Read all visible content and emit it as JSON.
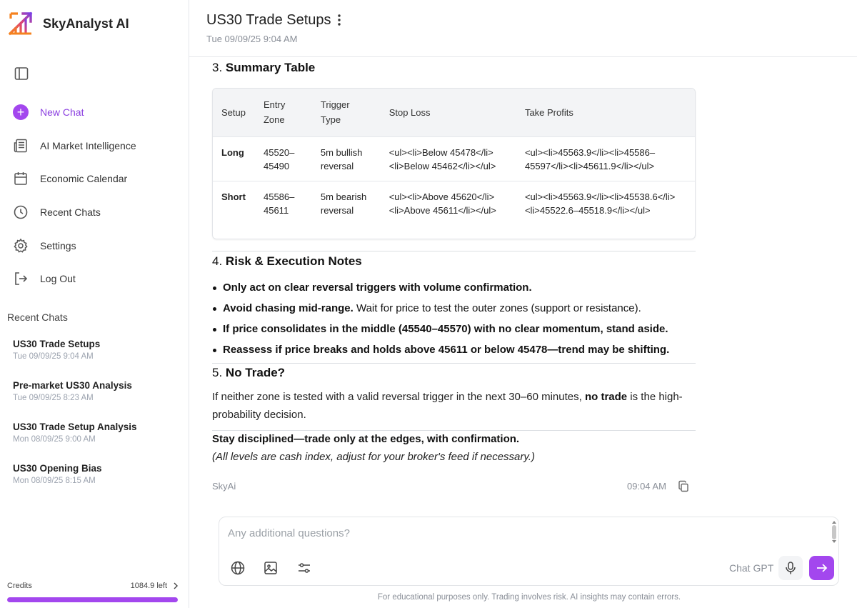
{
  "app": {
    "name": "SkyAnalyst AI"
  },
  "sidebar": {
    "nav": [
      {
        "label": "New Chat",
        "icon": "plus-circle-icon"
      },
      {
        "label": "AI Market Intelligence",
        "icon": "newspaper-icon"
      },
      {
        "label": "Economic Calendar",
        "icon": "calendar-icon"
      },
      {
        "label": "Recent Chats",
        "icon": "clock-icon"
      },
      {
        "label": "Settings",
        "icon": "gear-icon"
      },
      {
        "label": "Log Out",
        "icon": "logout-icon"
      }
    ],
    "recent_title": "Recent Chats",
    "recent": [
      {
        "title": "US30 Trade Setups",
        "date": "Tue 09/09/25 9:04 AM"
      },
      {
        "title": "Pre-market US30 Analysis",
        "date": "Tue 09/09/25 8:23 AM"
      },
      {
        "title": "US30 Trade Setup Analysis",
        "date": "Mon 08/09/25 9:00 AM"
      },
      {
        "title": "US30 Opening Bias",
        "date": "Mon 08/09/25 8:15 AM"
      }
    ],
    "credits": {
      "label": "Credits",
      "value": "1084.9 left",
      "fill_fraction": 1.0
    }
  },
  "header": {
    "title": "US30 Trade Setups",
    "date": "Tue 09/09/25 9:04 AM"
  },
  "content": {
    "sec3": {
      "num": "3.",
      "title": "Summary Table"
    },
    "table": {
      "headers": [
        "Setup",
        "Entry Zone",
        "Trigger Type",
        "Stop Loss",
        "Take Profits"
      ],
      "rows": [
        [
          "Long",
          "45520–45490",
          "5m bullish reversal",
          "<ul><li>Below 45478</li><li>Below 45462</li></ul>",
          "<ul><li>45563.9</li><li>45586–45597</li><li>45611.9</li></ul>"
        ],
        [
          "Short",
          "45586–45611",
          "5m bearish reversal",
          "<ul><li>Above 45620</li><li>Above 45611</li></ul>",
          "<ul><li>45563.9</li><li>45538.6</li><li>45522.6–45518.9</li></ul>"
        ]
      ]
    },
    "sec4": {
      "num": "4.",
      "title": "Risk & Execution Notes"
    },
    "bullets": [
      {
        "bold": "Only act on clear reversal triggers with volume confirmation.",
        "rest": ""
      },
      {
        "bold": "Avoid chasing mid-range.",
        "rest": " Wait for price to test the outer zones (support or resistance)."
      },
      {
        "bold": "If price consolidates in the middle (45540–45570) with no clear momentum, stand aside.",
        "rest": ""
      },
      {
        "bold": "Reassess if price breaks and holds above 45611 or below 45478—trend may be shifting.",
        "rest": ""
      }
    ],
    "sec5": {
      "num": "5.",
      "title": "No Trade?"
    },
    "para": {
      "before": "If neither zone is tested with a valid reversal trigger in the next 30–60 minutes, ",
      "bold": "no trade",
      "after": " is the high-probability decision."
    },
    "closing": "Stay disciplined—trade only at the edges, with confirmation.",
    "note": "(All levels are cash index, adjust for your broker's feed if necessary.)"
  },
  "message_footer": {
    "author": "SkyAi",
    "time": "09:04 AM"
  },
  "composer": {
    "placeholder": "Any additional questions?",
    "model": "Chat GPT"
  },
  "disclaimer": "For educational purposes only. Trading involves risk. AI insights may contain errors.",
  "colors": {
    "accent": "#a347ee",
    "accent_text": "#8b3fe0",
    "logo_orange": "#f5821f",
    "logo_purple": "#7b3fe4"
  }
}
